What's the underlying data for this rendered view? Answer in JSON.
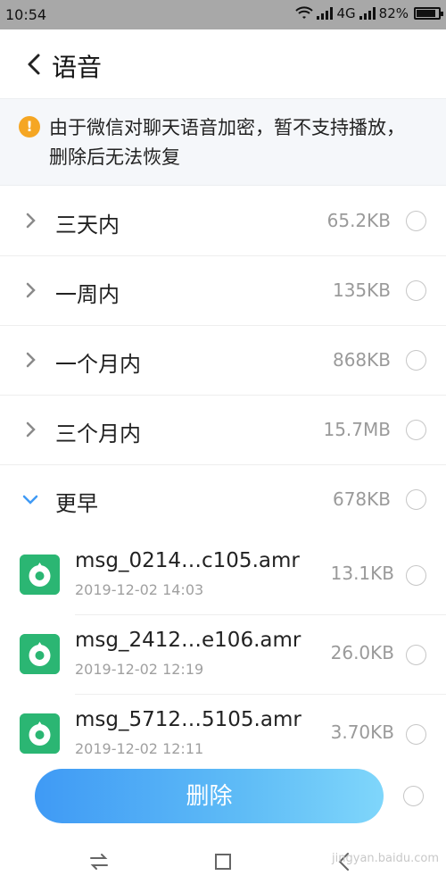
{
  "status_bar": {
    "time": "10:54",
    "network": "4G",
    "battery_percent": "82%",
    "battery_level": 0.82
  },
  "header": {
    "title": "语音",
    "back_icon": "chevron-left-icon"
  },
  "notice": {
    "icon": "warning-icon",
    "icon_color": "#f5a623",
    "text": "由于微信对聊天语音加密，暂不支持播放，删除后无法恢复"
  },
  "groups": [
    {
      "label": "三天内",
      "size": "65.2KB",
      "expanded": false
    },
    {
      "label": "一周内",
      "size": "135KB",
      "expanded": false
    },
    {
      "label": "一个月内",
      "size": "868KB",
      "expanded": false
    },
    {
      "label": "三个月内",
      "size": "15.7MB",
      "expanded": false
    },
    {
      "label": "更早",
      "size": "678KB",
      "expanded": true
    }
  ],
  "files": [
    {
      "name": "msg_0214…c105.amr",
      "date": "2019-12-02 14:03",
      "size": "13.1KB"
    },
    {
      "name": "msg_2412…e106.amr",
      "date": "2019-12-02 12:19",
      "size": "26.0KB"
    },
    {
      "name": "msg_5712…5105.amr",
      "date": "2019-12-02 12:11",
      "size": "3.70KB"
    }
  ],
  "delete_button": {
    "label": "删除",
    "color_start": "#3f9af5",
    "color_end": "#7fd6fb"
  },
  "navbar": {
    "icons": [
      "switch-arrows-icon",
      "home-square-icon",
      "back-arrow-icon"
    ]
  },
  "watermark": "jingyan.baidu.com",
  "colors": {
    "accent": "#3f9af5",
    "file_icon": "#2bb673",
    "muted_text": "#9a9a9a"
  }
}
